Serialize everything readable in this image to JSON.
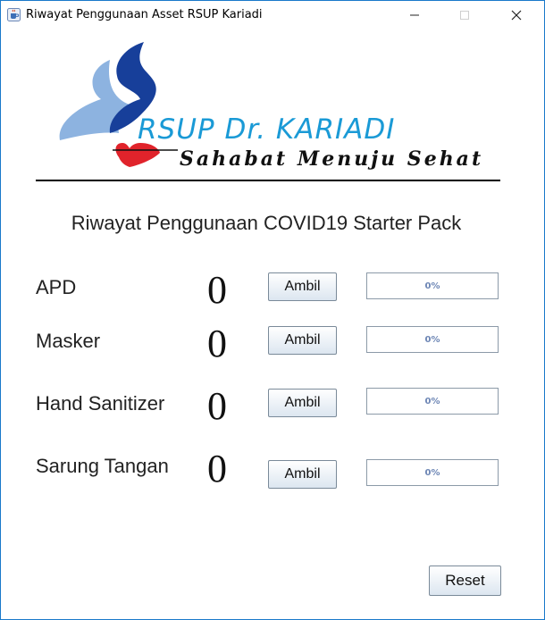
{
  "window": {
    "title": "Riwayat Penggunaan Asset RSUP Kariadi",
    "controls": [
      "minimize-icon",
      "maximize-icon",
      "close-icon"
    ]
  },
  "logo": {
    "name": "RSUP Dr. KARIADI",
    "slogan": "Sahabat Menuju Sehat",
    "colors": {
      "primary": "#1a9ad6",
      "dark_blue": "#173f9a",
      "light_blue": "#8db3e0",
      "heart": "#e0232b"
    }
  },
  "heading": "Riwayat Penggunaan COVID19 Starter Pack",
  "items": [
    {
      "label": "APD",
      "count": "0",
      "button": "Ambil",
      "progress_text": "0%",
      "progress": 0
    },
    {
      "label": "Masker",
      "count": "0",
      "button": "Ambil",
      "progress_text": "0%",
      "progress": 0
    },
    {
      "label": "Hand Sanitizer",
      "count": "0",
      "button": "Ambil",
      "progress_text": "0%",
      "progress": 0
    },
    {
      "label": "Sarung Tangan",
      "count": "0",
      "button": "Ambil",
      "progress_text": "0%",
      "progress": 0
    }
  ],
  "reset_label": "Reset"
}
